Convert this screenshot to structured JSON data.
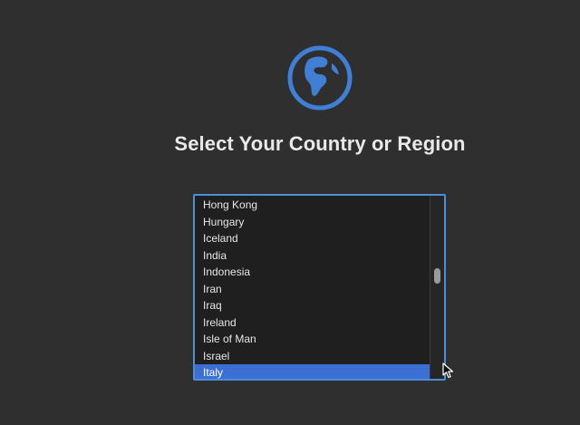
{
  "header": {
    "title": "Select Your Country or Region",
    "icon": "globe-icon",
    "accent_color": "#3f7fd6"
  },
  "country_list": {
    "items": [
      {
        "label": "Hong Kong",
        "selected": false
      },
      {
        "label": "Hungary",
        "selected": false
      },
      {
        "label": "Iceland",
        "selected": false
      },
      {
        "label": "India",
        "selected": false
      },
      {
        "label": "Indonesia",
        "selected": false
      },
      {
        "label": "Iran",
        "selected": false
      },
      {
        "label": "Iraq",
        "selected": false
      },
      {
        "label": "Ireland",
        "selected": false
      },
      {
        "label": "Isle of Man",
        "selected": false
      },
      {
        "label": "Israel",
        "selected": false
      },
      {
        "label": "Italy",
        "selected": true
      }
    ],
    "selected_value": "Italy",
    "selection_color": "#3b6fd3"
  }
}
